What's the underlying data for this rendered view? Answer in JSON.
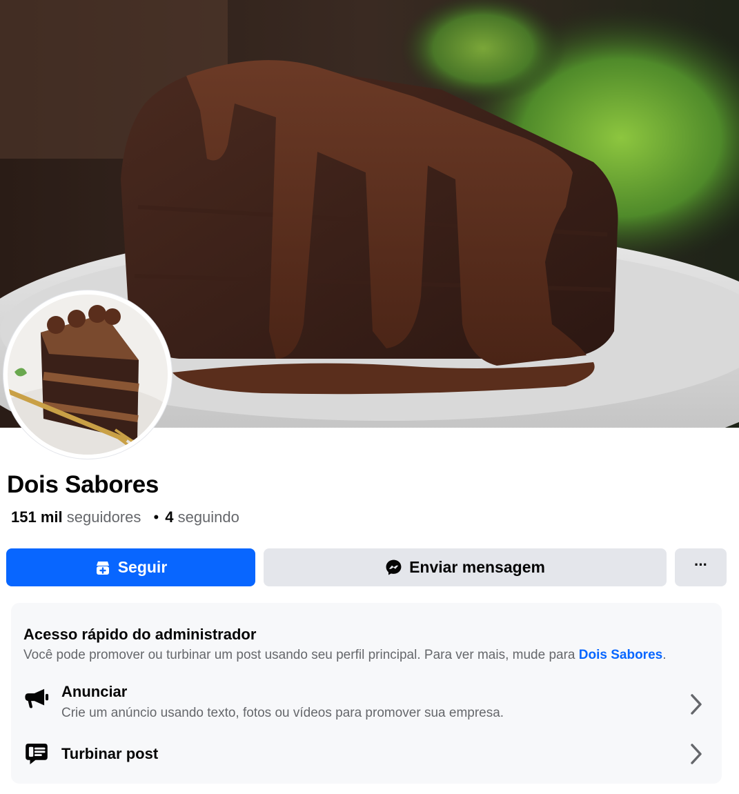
{
  "profile": {
    "name": "Dois Sabores",
    "followers_count": "151 mil",
    "followers_label": "seguidores",
    "separator": "•",
    "following_count": "4",
    "following_label": "seguindo"
  },
  "actions": {
    "follow_label": "Seguir",
    "message_label": "Enviar mensagem",
    "more_label": "···"
  },
  "admin_panel": {
    "title": "Acesso rápido do administrador",
    "description": "Você pode promover ou turbinar um post usando seu perfil principal. Para ver mais, mude para ",
    "description_link": "Dois Sabores",
    "description_end": ".",
    "items": [
      {
        "icon": "megaphone-icon",
        "title": "Anunciar",
        "subtitle": "Crie um anúncio usando texto, fotos ou vídeos para promover sua empresa."
      },
      {
        "icon": "boost-post-icon",
        "title": "Turbinar post"
      }
    ]
  },
  "colors": {
    "accent": "#0866ff",
    "secondary_button": "#e4e6eb",
    "panel_bg": "#f7f8fa",
    "muted_text": "#65676b"
  }
}
